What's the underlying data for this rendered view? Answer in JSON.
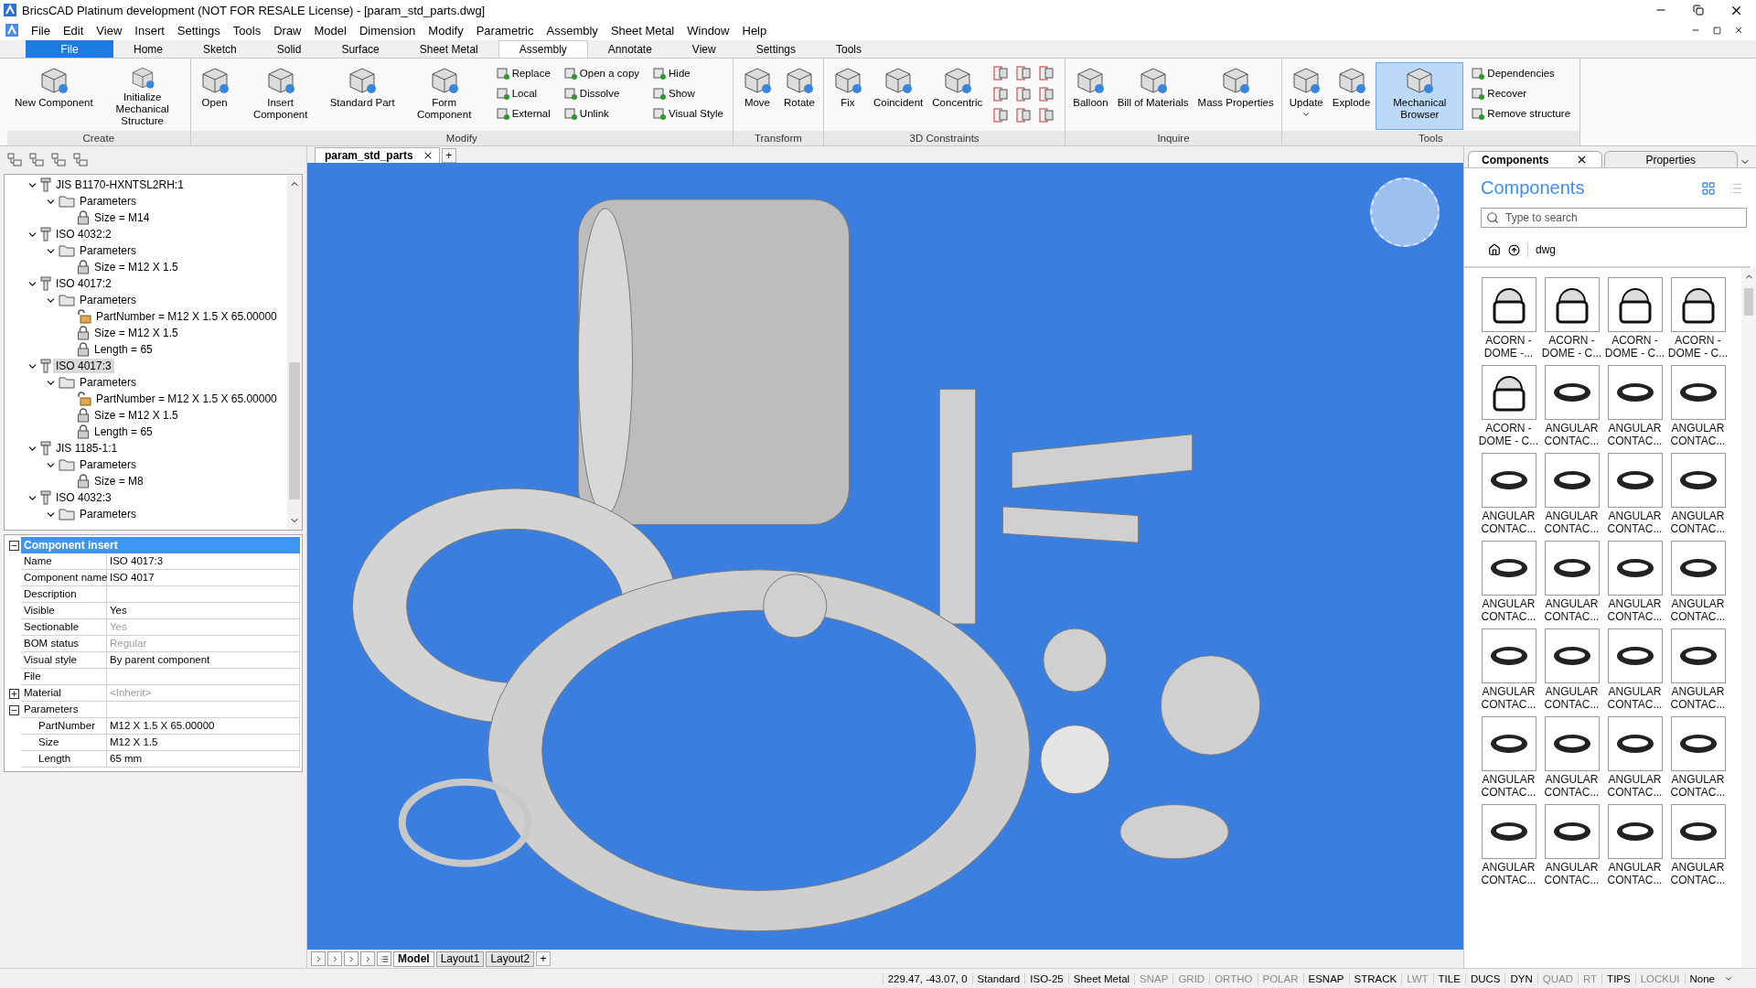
{
  "title_bar": {
    "title": "BricsCAD Platinum development (NOT FOR RESALE License) - [param_std_parts.dwg]"
  },
  "menu": [
    "File",
    "Edit",
    "View",
    "Insert",
    "Settings",
    "Tools",
    "Draw",
    "Model",
    "Dimension",
    "Modify",
    "Parametric",
    "Assembly",
    "Sheet Metal",
    "Window",
    "Help"
  ],
  "ribbon_tabs": [
    {
      "label": "File",
      "selected": false,
      "kind": "file"
    },
    {
      "label": "Home",
      "selected": false,
      "kind": "tab"
    },
    {
      "label": "Sketch",
      "selected": false,
      "kind": "tab"
    },
    {
      "label": "Solid",
      "selected": false,
      "kind": "tab"
    },
    {
      "label": "Surface",
      "selected": false,
      "kind": "tab"
    },
    {
      "label": "Sheet Metal",
      "selected": false,
      "kind": "tab"
    },
    {
      "label": "Assembly",
      "selected": true,
      "kind": "tab"
    },
    {
      "label": "Annotate",
      "selected": false,
      "kind": "tab"
    },
    {
      "label": "View",
      "selected": false,
      "kind": "tab"
    },
    {
      "label": "Settings",
      "selected": false,
      "kind": "tab"
    },
    {
      "label": "Tools",
      "selected": false,
      "kind": "tab"
    }
  ],
  "ribbon_panels": [
    {
      "title": "Create",
      "groups": [
        {
          "kind": "large",
          "label": "New Component",
          "selected": false,
          "dropdown": false
        },
        {
          "kind": "large",
          "label": "Initialize Mechanical Structure",
          "selected": false,
          "dropdown": false
        }
      ]
    },
    {
      "title": "Modify",
      "groups": [
        {
          "kind": "large",
          "label": "Open",
          "selected": false,
          "dropdown": false
        },
        {
          "kind": "large",
          "label": "Insert Component",
          "selected": false,
          "dropdown": false
        },
        {
          "kind": "large",
          "label": "Standard Part",
          "selected": false,
          "dropdown": false
        },
        {
          "kind": "large",
          "label": "Form Component",
          "selected": false,
          "dropdown": false
        },
        {
          "kind": "stack",
          "items": [
            "Replace",
            "Local",
            "External"
          ]
        },
        {
          "kind": "stack",
          "items": [
            "Open a copy",
            "Dissolve",
            "Unlink"
          ]
        },
        {
          "kind": "stack",
          "items": [
            "Hide",
            "Show",
            "Visual Style"
          ]
        }
      ]
    },
    {
      "title": "Transform",
      "groups": [
        {
          "kind": "large",
          "label": "Move",
          "selected": false,
          "dropdown": false
        },
        {
          "kind": "large",
          "label": "Rotate",
          "selected": false,
          "dropdown": false
        }
      ]
    },
    {
      "title": "3D Constraints",
      "groups": [
        {
          "kind": "large",
          "label": "Fix",
          "selected": false,
          "dropdown": false
        },
        {
          "kind": "large",
          "label": "Coincident",
          "selected": false,
          "dropdown": false
        },
        {
          "kind": "large",
          "label": "Concentric",
          "selected": false,
          "dropdown": false
        },
        {
          "kind": "icon_grid"
        }
      ]
    },
    {
      "title": "Inquire",
      "groups": [
        {
          "kind": "large",
          "label": "Balloon",
          "selected": false,
          "dropdown": false
        },
        {
          "kind": "large",
          "label": "Bill of Materials",
          "selected": false,
          "dropdown": false
        },
        {
          "kind": "large",
          "label": "Mass Properties",
          "selected": false,
          "dropdown": false
        }
      ]
    },
    {
      "title": "Tools",
      "groups": [
        {
          "kind": "large",
          "label": "Update",
          "selected": false,
          "dropdown": true
        },
        {
          "kind": "large",
          "label": "Explode",
          "selected": false,
          "dropdown": false
        },
        {
          "kind": "large",
          "label": "Mechanical Browser",
          "selected": true,
          "dropdown": false
        },
        {
          "kind": "stack",
          "items": [
            "Dependencies",
            "Recover",
            "Remove structure"
          ]
        }
      ]
    }
  ],
  "tree": [
    {
      "label": "JIS B1170-HXNTSL2RH:1",
      "kind": "part",
      "expanded": true,
      "selected": false,
      "children": [
        {
          "label": "Parameters",
          "kind": "folder",
          "expanded": true,
          "selected": false,
          "children": [
            {
              "label": "Size = M14",
              "kind": "param",
              "locked": true,
              "selected": false
            }
          ]
        }
      ]
    },
    {
      "label": "ISO 4032:2",
      "kind": "part",
      "expanded": true,
      "selected": false,
      "children": [
        {
          "label": "Parameters",
          "kind": "folder",
          "expanded": true,
          "selected": false,
          "children": [
            {
              "label": "Size = M12 X 1.5",
              "kind": "param",
              "locked": true,
              "selected": false
            }
          ]
        }
      ]
    },
    {
      "label": "ISO 4017:2",
      "kind": "part",
      "expanded": true,
      "selected": false,
      "children": [
        {
          "label": "Parameters",
          "kind": "folder",
          "expanded": true,
          "selected": false,
          "children": [
            {
              "label": "PartNumber = M12 X 1.5 X 65.00000",
              "kind": "param",
              "locked": false,
              "selected": false
            },
            {
              "label": "Size = M12 X 1.5",
              "kind": "param",
              "locked": true,
              "selected": false
            },
            {
              "label": "Length = 65",
              "kind": "param",
              "locked": true,
              "selected": false
            }
          ]
        }
      ]
    },
    {
      "label": "ISO 4017:3",
      "kind": "part",
      "expanded": true,
      "selected": true,
      "children": [
        {
          "label": "Parameters",
          "kind": "folder",
          "expanded": true,
          "selected": false,
          "children": [
            {
              "label": "PartNumber = M12 X 1.5 X 65.00000",
              "kind": "param",
              "locked": false,
              "selected": false
            },
            {
              "label": "Size = M12 X 1.5",
              "kind": "param",
              "locked": true,
              "selected": false
            },
            {
              "label": "Length = 65",
              "kind": "param",
              "locked": true,
              "selected": false
            }
          ]
        }
      ]
    },
    {
      "label": "JIS 1185-1:1",
      "kind": "part",
      "expanded": true,
      "selected": false,
      "children": [
        {
          "label": "Parameters",
          "kind": "folder",
          "expanded": true,
          "selected": false,
          "children": [
            {
              "label": "Size = M8",
              "kind": "param",
              "locked": true,
              "selected": false
            }
          ]
        }
      ]
    },
    {
      "label": "ISO 4032:3",
      "kind": "part",
      "expanded": true,
      "selected": false,
      "children": [
        {
          "label": "Parameters",
          "kind": "folder",
          "expanded": true,
          "selected": false
        }
      ]
    }
  ],
  "properties": {
    "title": "Component insert",
    "expanded": true,
    "rows": [
      {
        "kind": "field",
        "name": "Name",
        "value": "ISO 4017:3",
        "muted": false
      },
      {
        "kind": "field",
        "name": "Component name",
        "value": "ISO 4017",
        "muted": false
      },
      {
        "kind": "field",
        "name": "Description",
        "muted": false
      },
      {
        "kind": "field",
        "name": "Visible",
        "value": "Yes",
        "muted": false
      },
      {
        "kind": "field",
        "name": "Sectionable",
        "value": "Yes",
        "muted": true
      },
      {
        "kind": "field",
        "name": "BOM status",
        "value": "Regular",
        "muted": true
      },
      {
        "kind": "field",
        "name": "Visual style",
        "value": "By parent component",
        "muted": false
      },
      {
        "kind": "field",
        "name": "File",
        "muted": false
      },
      {
        "kind": "group",
        "name": "Material",
        "value": "<Inherit>",
        "muted": true,
        "expanded": false
      },
      {
        "kind": "group",
        "name": "Parameters",
        "muted": false,
        "expanded": true,
        "rows": [
          {
            "kind": "field",
            "name": "PartNumber",
            "value": "M12 X 1.5 X 65.00000",
            "muted": false
          },
          {
            "kind": "field",
            "name": "Size",
            "value": "M12 X 1.5",
            "muted": false
          },
          {
            "kind": "field",
            "name": "Length",
            "value": "65 mm",
            "muted": false
          }
        ]
      }
    ]
  },
  "document_tabs": [
    {
      "label": "param_std_parts",
      "selected": true
    }
  ],
  "new_tab": "+",
  "layout_tabs": [
    {
      "label": "Model",
      "selected": true
    },
    {
      "label": "Layout1",
      "selected": false
    },
    {
      "label": "Layout2",
      "selected": false
    }
  ],
  "new_layout": "+",
  "right_panel": {
    "tabs": [
      {
        "label": "Components",
        "selected": true
      },
      {
        "label": "Properties",
        "selected": false
      }
    ],
    "heading": "Components",
    "search": {
      "placeholder": "Type to search"
    },
    "breadcrumb": "dwg",
    "items": [
      {
        "label": "ACORN - DOME -...",
        "kind": "acorn"
      },
      {
        "label": "ACORN - DOME - C...",
        "kind": "acorn"
      },
      {
        "label": "ACORN - DOME - C...",
        "kind": "acorn"
      },
      {
        "label": "ACORN - DOME - C...",
        "kind": "acorn"
      },
      {
        "label": "ACORN - DOME - C...",
        "kind": "acorn"
      },
      {
        "label": "ANGULAR CONTAC...",
        "kind": "bearing"
      },
      {
        "label": "ANGULAR CONTAC...",
        "kind": "bearing"
      },
      {
        "label": "ANGULAR CONTAC...",
        "kind": "bearing"
      },
      {
        "label": "ANGULAR CONTAC...",
        "kind": "bearing"
      },
      {
        "label": "ANGULAR CONTAC...",
        "kind": "bearing"
      },
      {
        "label": "ANGULAR CONTAC...",
        "kind": "bearing"
      },
      {
        "label": "ANGULAR CONTAC...",
        "kind": "bearing"
      },
      {
        "label": "ANGULAR CONTAC...",
        "kind": "bearing"
      },
      {
        "label": "ANGULAR CONTAC...",
        "kind": "bearing"
      },
      {
        "label": "ANGULAR CONTAC...",
        "kind": "bearing"
      },
      {
        "label": "ANGULAR CONTAC...",
        "kind": "bearing"
      },
      {
        "label": "ANGULAR CONTAC...",
        "kind": "bearing"
      },
      {
        "label": "ANGULAR CONTAC...",
        "kind": "bearing"
      },
      {
        "label": "ANGULAR CONTAC...",
        "kind": "bearing"
      },
      {
        "label": "ANGULAR CONTAC...",
        "kind": "bearing"
      },
      {
        "label": "ANGULAR CONTAC...",
        "kind": "bearing"
      },
      {
        "label": "ANGULAR CONTAC...",
        "kind": "bearing"
      },
      {
        "label": "ANGULAR CONTAC...",
        "kind": "bearing"
      },
      {
        "label": "ANGULAR CONTAC...",
        "kind": "bearing"
      },
      {
        "label": "ANGULAR CONTAC...",
        "kind": "bearing"
      },
      {
        "label": "ANGULAR CONTAC...",
        "kind": "bearing"
      },
      {
        "label": "ANGULAR CONTAC...",
        "kind": "bearing"
      },
      {
        "label": "ANGULAR CONTAC...",
        "kind": "bearing"
      }
    ]
  },
  "status_bar": {
    "coordinates": "229.47, -43.07, 0",
    "fields": [
      "Standard",
      "ISO-25",
      "Sheet Metal"
    ],
    "toggles": [
      {
        "label": "SNAP",
        "on": false
      },
      {
        "label": "GRID",
        "on": false
      },
      {
        "label": "ORTHO",
        "on": false
      },
      {
        "label": "POLAR",
        "on": false
      },
      {
        "label": "ESNAP",
        "on": true
      },
      {
        "label": "STRACK",
        "on": true
      },
      {
        "label": "LWT",
        "on": false
      },
      {
        "label": "TILE",
        "on": true
      },
      {
        "label": "DUCS",
        "on": true
      },
      {
        "label": "DYN",
        "on": true
      },
      {
        "label": "QUAD",
        "on": false
      },
      {
        "label": "RT",
        "on": false
      },
      {
        "label": "TIPS",
        "on": true
      },
      {
        "label": "LOCKUI",
        "on": false
      }
    ],
    "dropdown": "None"
  }
}
